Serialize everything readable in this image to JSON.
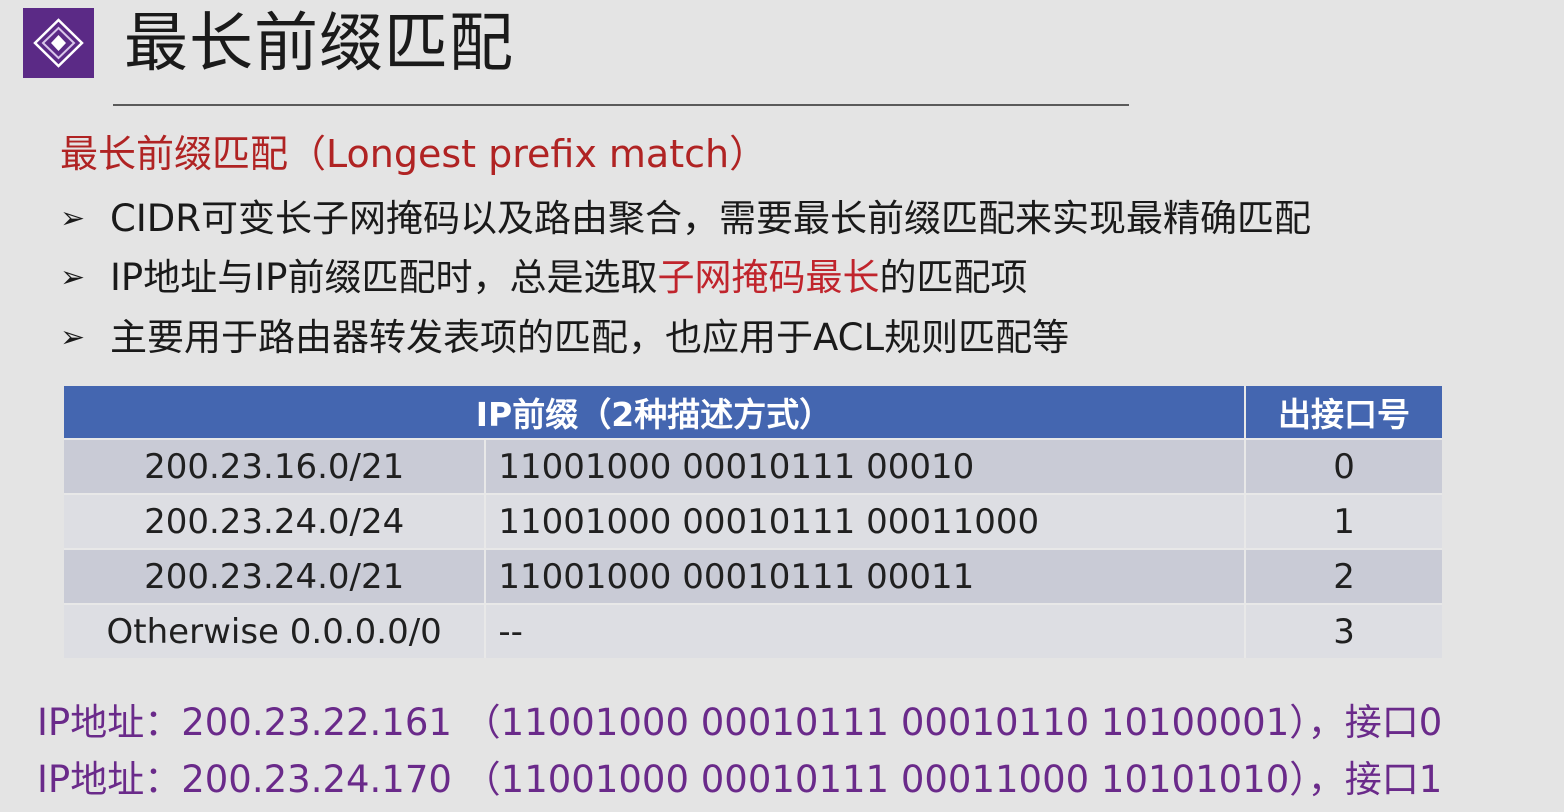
{
  "slide": {
    "title": "最长前缀匹配",
    "subtitle": "最长前缀匹配（Longest prefix match）",
    "bullets": [
      {
        "text": "CIDR可变长子网掩码以及路由聚合，需要最长前缀匹配来实现最精确匹配"
      },
      {
        "text_before": "IP地址与IP前缀匹配时，总是选取",
        "text_highlight": "子网掩码最长",
        "text_after": "的匹配项"
      },
      {
        "text": "主要用于路由器转发表项的匹配，也应用于ACL规则匹配等"
      }
    ],
    "bullet_symbol": "➢"
  },
  "table": {
    "header_prefix": "IP前缀（2种描述方式）",
    "header_port": "出接口号",
    "rows": [
      {
        "cidr": "200.23.16.0/21",
        "binary": "11001000 00010111 00010",
        "port": "0"
      },
      {
        "cidr": "200.23.24.0/24",
        "binary": "11001000 00010111 00011000",
        "port": "1"
      },
      {
        "cidr": "200.23.24.0/21",
        "binary": "11001000 00010111 00011",
        "port": "2"
      },
      {
        "cidr": "Otherwise 0.0.0.0/0",
        "binary": "--",
        "port": "3"
      }
    ]
  },
  "examples": [
    {
      "text": "IP地址：200.23.22.161 （11001000  00010111  00010110  10100001），接口0"
    },
    {
      "text": "IP地址：200.23.24.170 （11001000  00010111  00011000  10101010），接口1"
    }
  ],
  "colors": {
    "title_text": "#1a1a1a",
    "subtitle_red": "#b02323",
    "highlight_red": "#c0242c",
    "header_blue": "#4466b0",
    "example_purple": "#6a2a8a",
    "logo_purple": "#5b2a86"
  },
  "icons": {
    "logo": "diamond-target-logo-icon"
  }
}
